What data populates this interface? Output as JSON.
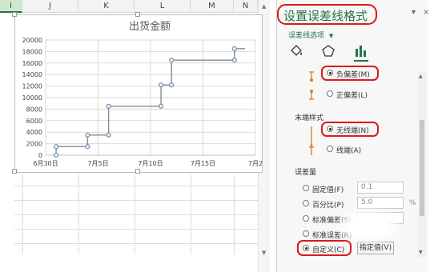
{
  "spreadsheet": {
    "columns": [
      "I",
      "J",
      "K",
      "L",
      "M",
      "N"
    ]
  },
  "chart": {
    "title": "出货金额"
  },
  "chart_data": {
    "type": "line",
    "title": "出货金额",
    "x_labels": [
      "6月30日",
      "7月5日",
      "7月10日",
      "7月15日",
      "7月2"
    ],
    "y_labels": [
      "0",
      "2000",
      "4000",
      "6000",
      "8000",
      "10000",
      "12000",
      "14000",
      "16000",
      "18000",
      "20000"
    ],
    "ylim": [
      0,
      20000
    ],
    "xlim": [
      "6月30日",
      "7月20日"
    ],
    "grid": true,
    "series": [
      {
        "points": [
          {
            "x": "7月1日",
            "y": 0
          },
          {
            "x": "7月1日",
            "y": 1500
          },
          {
            "x": "7月4日",
            "y": 1500
          },
          {
            "x": "7月4日",
            "y": 3500
          },
          {
            "x": "7月6日",
            "y": 3500
          },
          {
            "x": "7月6日",
            "y": 8500
          },
          {
            "x": "7月11日",
            "y": 8500
          },
          {
            "x": "7月11日",
            "y": 12200
          },
          {
            "x": "7月12日",
            "y": 12200
          },
          {
            "x": "7月12日",
            "y": 16500
          },
          {
            "x": "7月18日",
            "y": 16500
          },
          {
            "x": "7月18日",
            "y": 18500
          },
          {
            "x": "7月19日",
            "y": 18500
          }
        ]
      }
    ],
    "color": "#6f8fb7"
  },
  "panel": {
    "title": "设置误差线格式",
    "options_label": "误差线选项",
    "dir_minus": "负偏差(M)",
    "dir_plus": "正偏差(L)",
    "end_style_label": "末端样式",
    "end_none": "无线端(N)",
    "end_cap": "线端(A)",
    "amount_label": "误差量",
    "fixed": "固定值(F)",
    "fixed_value": "0.1",
    "percent": "百分比(P)",
    "percent_value": "5.0",
    "percent_unit": "%",
    "stddev": "标准偏差(S)",
    "stderr": "标准误差(R)",
    "custom": "自定义(C)",
    "specify_button": "指定值(V)",
    "dropdown_icon": "▼",
    "close_icon": "×",
    "pin_icon": "▾",
    "fill_icon": "paint-bucket-icon",
    "effects_icon": "pentagon-icon",
    "bars_icon": "bar-chart-icon"
  }
}
